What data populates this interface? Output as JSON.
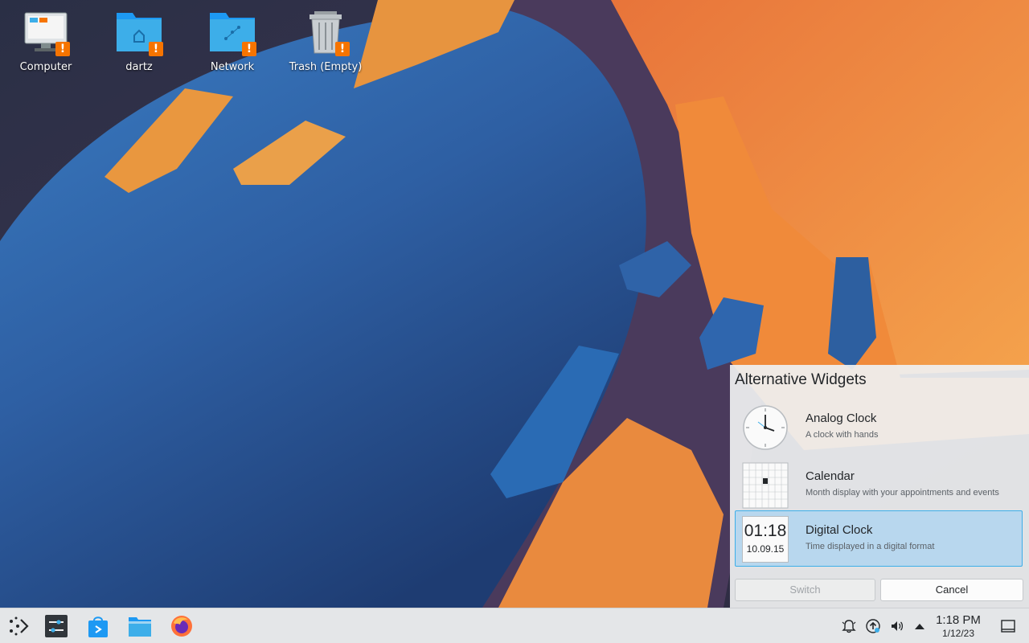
{
  "desktop": {
    "icons": [
      {
        "label": "Computer"
      },
      {
        "label": "dartz"
      },
      {
        "label": "Network"
      },
      {
        "label": "Trash (Empty)"
      }
    ],
    "badge_glyph": "!"
  },
  "alt_widgets": {
    "title": "Alternative Widgets",
    "items": [
      {
        "name": "Analog Clock",
        "description": "A clock with hands",
        "icon": "analog-clock-icon",
        "selected": false
      },
      {
        "name": "Calendar",
        "description": "Month display with your appointments and events",
        "icon": "calendar-icon",
        "selected": false
      },
      {
        "name": "Digital Clock",
        "description": "Time displayed in a digital format",
        "icon": "digital-clock-icon",
        "selected": true,
        "preview_time": "01:18",
        "preview_date": "10.09.15"
      }
    ],
    "switch_label": "Switch",
    "cancel_label": "Cancel"
  },
  "taskbar": {
    "launchers": [
      "application-launcher-icon",
      "system-settings-icon",
      "discover-icon",
      "dolphin-file-manager-icon",
      "firefox-icon"
    ],
    "tray": [
      "notifications-icon",
      "updates-icon",
      "volume-icon",
      "expand-tray-icon"
    ],
    "clock_time": "1:18 PM",
    "clock_date": "1/12/23",
    "show_desktop": "show-desktop-icon"
  },
  "colors": {
    "accent": "#3daee9",
    "selection": "#b8d7ee",
    "warning": "#f67400",
    "folder": "#3daee9"
  }
}
